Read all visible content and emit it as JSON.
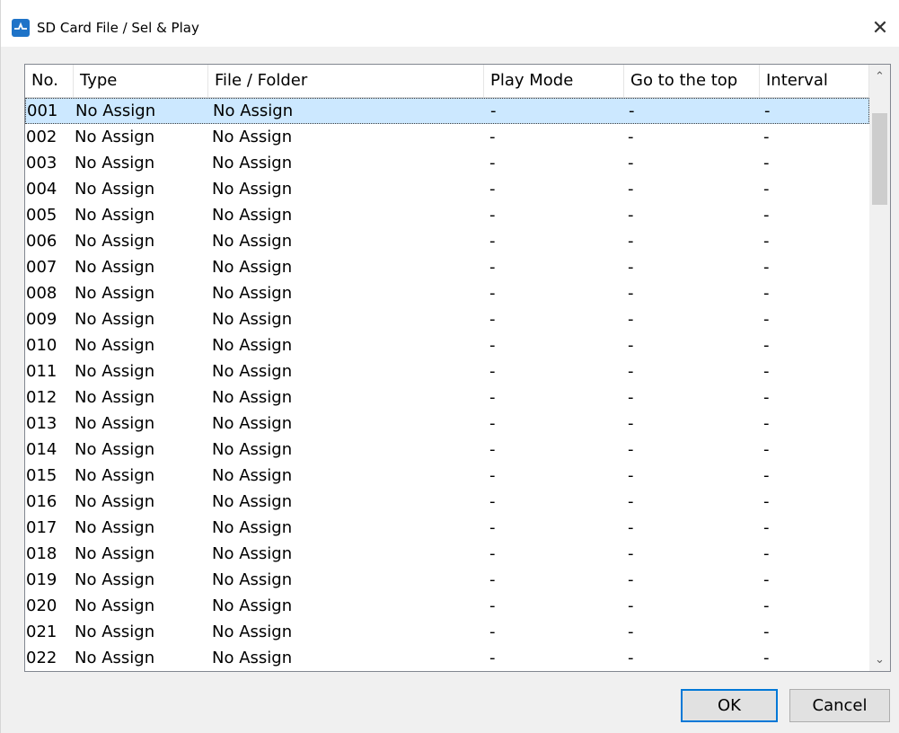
{
  "window": {
    "title": "SD Card File / Sel & Play",
    "close_glyph": "✕"
  },
  "table": {
    "columns": [
      "No.",
      "Type",
      "File / Folder",
      "Play Mode",
      "Go to the top",
      "Interval"
    ],
    "rows": [
      [
        "001",
        "No Assign",
        "No Assign",
        "-",
        "-",
        "-"
      ],
      [
        "002",
        "No Assign",
        "No Assign",
        "-",
        "-",
        "-"
      ],
      [
        "003",
        "No Assign",
        "No Assign",
        "-",
        "-",
        "-"
      ],
      [
        "004",
        "No Assign",
        "No Assign",
        "-",
        "-",
        "-"
      ],
      [
        "005",
        "No Assign",
        "No Assign",
        "-",
        "-",
        "-"
      ],
      [
        "006",
        "No Assign",
        "No Assign",
        "-",
        "-",
        "-"
      ],
      [
        "007",
        "No Assign",
        "No Assign",
        "-",
        "-",
        "-"
      ],
      [
        "008",
        "No Assign",
        "No Assign",
        "-",
        "-",
        "-"
      ],
      [
        "009",
        "No Assign",
        "No Assign",
        "-",
        "-",
        "-"
      ],
      [
        "010",
        "No Assign",
        "No Assign",
        "-",
        "-",
        "-"
      ],
      [
        "011",
        "No Assign",
        "No Assign",
        "-",
        "-",
        "-"
      ],
      [
        "012",
        "No Assign",
        "No Assign",
        "-",
        "-",
        "-"
      ],
      [
        "013",
        "No Assign",
        "No Assign",
        "-",
        "-",
        "-"
      ],
      [
        "014",
        "No Assign",
        "No Assign",
        "-",
        "-",
        "-"
      ],
      [
        "015",
        "No Assign",
        "No Assign",
        "-",
        "-",
        "-"
      ],
      [
        "016",
        "No Assign",
        "No Assign",
        "-",
        "-",
        "-"
      ],
      [
        "017",
        "No Assign",
        "No Assign",
        "-",
        "-",
        "-"
      ],
      [
        "018",
        "No Assign",
        "No Assign",
        "-",
        "-",
        "-"
      ],
      [
        "019",
        "No Assign",
        "No Assign",
        "-",
        "-",
        "-"
      ],
      [
        "020",
        "No Assign",
        "No Assign",
        "-",
        "-",
        "-"
      ],
      [
        "021",
        "No Assign",
        "No Assign",
        "-",
        "-",
        "-"
      ],
      [
        "022",
        "No Assign",
        "No Assign",
        "-",
        "-",
        "-"
      ]
    ],
    "selected_row_index": 0
  },
  "scrollbar": {
    "up_glyph": "⌃",
    "down_glyph": "⌄"
  },
  "buttons": {
    "ok_label": "OK",
    "cancel_label": "Cancel"
  },
  "colors": {
    "selection": "#cce8ff",
    "default_button_border": "#0078d7",
    "app_icon": "#1e73c8"
  }
}
